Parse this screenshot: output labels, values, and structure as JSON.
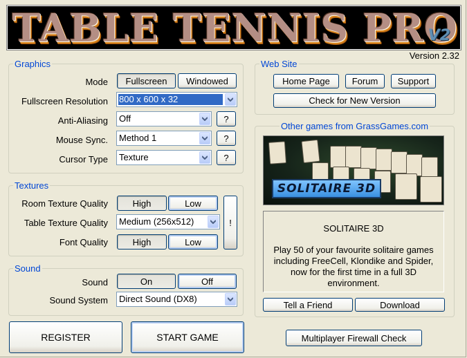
{
  "banner": {
    "title": "TABLE TENNIS PRO",
    "badge": "V2"
  },
  "version": "Version 2.32",
  "graphics": {
    "legend": "Graphics",
    "mode": {
      "label": "Mode",
      "options": [
        "Fullscreen",
        "Windowed"
      ],
      "selected": "Fullscreen"
    },
    "resolution": {
      "label": "Fullscreen Resolution",
      "value": "800 x 600 x 32"
    },
    "anti_aliasing": {
      "label": "Anti-Aliasing",
      "value": "Off",
      "help": "?"
    },
    "mouse_sync": {
      "label": "Mouse Sync.",
      "value": "Method 1",
      "help": "?"
    },
    "cursor_type": {
      "label": "Cursor Type",
      "value": "Texture",
      "help": "?"
    }
  },
  "textures": {
    "legend": "Textures",
    "room": {
      "label": "Room Texture Quality",
      "options": [
        "High",
        "Low"
      ],
      "selected": "High"
    },
    "table": {
      "label": "Table Texture Quality",
      "value": "Medium (256x512)"
    },
    "font": {
      "label": "Font Quality",
      "options": [
        "High",
        "Low"
      ],
      "selected": "High"
    },
    "warning": "!"
  },
  "sound": {
    "legend": "Sound",
    "sound": {
      "label": "Sound",
      "options": [
        "On",
        "Off"
      ],
      "selected": "On"
    },
    "system": {
      "label": "Sound System",
      "value": "Direct Sound (DX8)"
    }
  },
  "website": {
    "legend": "Web Site",
    "home": "Home Page",
    "forum": "Forum",
    "support": "Support",
    "check": "Check for New Version"
  },
  "promo": {
    "legend": "Other games from GrassGames.com",
    "image_logo": "SOLITAIRE 3D",
    "title": "SOLITAIRE 3D",
    "description": "Play 50 of your favourite solitaire games including FreeCell, Klondike and Spider, now for the first time in a full 3D environment.",
    "tell_friend": "Tell a Friend",
    "download": "Download"
  },
  "actions": {
    "register": "REGISTER",
    "start": "START GAME",
    "firewall": "Multiplayer Firewall Check"
  }
}
